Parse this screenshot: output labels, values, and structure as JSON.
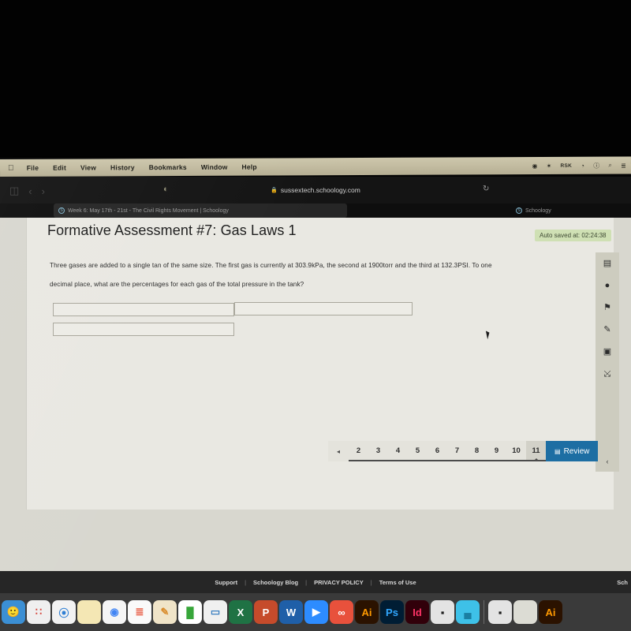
{
  "menubar": {
    "apple_icon": "apple-icon",
    "items": [
      "File",
      "Edit",
      "View",
      "History",
      "Bookmarks",
      "Window",
      "Help"
    ],
    "status_items": [
      {
        "name": "dropbox-icon",
        "glyph": "◉"
      },
      {
        "name": "bluetooth-icon",
        "glyph": "✶"
      },
      {
        "name": "rsk-icon",
        "glyph": "RSK"
      },
      {
        "name": "wifi-icon",
        "glyph": "◔"
      },
      {
        "name": "control-center-icon",
        "glyph": "ⓘ"
      },
      {
        "name": "spotlight-search-icon",
        "glyph": "⌕"
      },
      {
        "name": "siri-icon",
        "glyph": "≣"
      }
    ]
  },
  "browser": {
    "sidebar_toggle_icon": "sidebar-toggle-icon",
    "back_icon": "‹",
    "forward_icon": "›",
    "shield_icon": "◐",
    "lock_icon": "🔒",
    "url": "sussextech.schoology.com",
    "reload_icon": "↻",
    "tabs": [
      {
        "favicon": "S",
        "label": "Week 6: May 17th - 21st - The Civil Rights Movement | Schoology",
        "active": true
      },
      {
        "favicon": "S",
        "label": "Schoology",
        "active": false
      }
    ]
  },
  "assessment": {
    "title": "Formative Assessment #7: Gas Laws 1",
    "autosave": "Auto saved at: 02:24:38",
    "question_line_1": "Three gases are added to a single tan of the same size.  The first gas is currently at 303.9kPa, the second at 1900torr and the third at 132.3PSI.  To one",
    "question_line_2": "decimal place, what are the percentages for each gas of the total pressure in the tank?",
    "answer_fields": [
      {
        "name": "answer-field-1a",
        "value": "",
        "placeholder": ""
      },
      {
        "name": "answer-field-1b",
        "value": "",
        "placeholder": ""
      },
      {
        "name": "answer-field-2",
        "value": "",
        "placeholder": ""
      }
    ]
  },
  "toolrail": {
    "icons": [
      {
        "name": "calendar-icon",
        "glyph": "Ὄ5"
      },
      {
        "name": "clock-icon",
        "glyph": "●"
      },
      {
        "name": "flag-icon",
        "glyph": "⚑"
      },
      {
        "name": "pencil-annotate-icon",
        "glyph": "✎"
      },
      {
        "name": "calculator-icon",
        "glyph": "▣"
      },
      {
        "name": "fullscreen-expand-icon",
        "glyph": "⤡"
      }
    ],
    "collapse_icon": "‹"
  },
  "pager": {
    "prev_icon": "◂",
    "pages": [
      "2",
      "3",
      "4",
      "5",
      "6",
      "7",
      "8",
      "9",
      "10",
      "11"
    ],
    "active_page": "11",
    "review_icon": "Ὄ5",
    "review_label": "Review"
  },
  "footer": {
    "links": [
      "Support",
      "Schoology Blog",
      "PRIVACY POLICY",
      "Terms of Use"
    ],
    "separator": "|",
    "right_label": "Sch"
  },
  "dock": {
    "items": [
      {
        "name": "dock-finder",
        "label": "🙂",
        "bg": "#3b8fd4",
        "color": "#ffffff"
      },
      {
        "name": "dock-launchpad",
        "label": "∷",
        "bg": "#efefef",
        "color": "#d6453c"
      },
      {
        "name": "dock-safari",
        "label": "⦿",
        "bg": "#f2f2f2",
        "color": "#2f7fd4"
      },
      {
        "name": "dock-notes",
        "label": "",
        "bg": "#f4e7b4",
        "color": "#8a7a3a"
      },
      {
        "name": "dock-chrome",
        "label": "◉",
        "bg": "#f5f5f5",
        "color": "#4285f4"
      },
      {
        "name": "dock-reminders",
        "label": "≣",
        "bg": "#fafafa",
        "color": "#e8573f"
      },
      {
        "name": "dock-pages",
        "label": "✎",
        "bg": "#f0e4c8",
        "color": "#d98b2b"
      },
      {
        "name": "dock-numbers",
        "label": "█",
        "bg": "#ffffff",
        "color": "#37a63a"
      },
      {
        "name": "dock-keynote",
        "label": "▭",
        "bg": "#f0f0f0",
        "color": "#3a7fc1"
      },
      {
        "name": "dock-excel",
        "label": "X",
        "bg": "#1f7244",
        "color": "#ffffff"
      },
      {
        "name": "dock-powerpoint",
        "label": "P",
        "bg": "#c64b2b",
        "color": "#ffffff"
      },
      {
        "name": "dock-word",
        "label": "W",
        "bg": "#1f5fa8",
        "color": "#ffffff"
      },
      {
        "name": "dock-zoom",
        "label": "▶",
        "bg": "#2d8cff",
        "color": "#ffffff"
      },
      {
        "name": "dock-creative-cloud",
        "label": "∞",
        "bg": "#e8513c",
        "color": "#ffffff"
      },
      {
        "name": "dock-illustrator",
        "label": "Ai",
        "bg": "#2b1200",
        "color": "#ff9a00"
      },
      {
        "name": "dock-photoshop",
        "label": "Ps",
        "bg": "#001d34",
        "color": "#31a8ff"
      },
      {
        "name": "dock-indesign",
        "label": "Id",
        "bg": "#31000a",
        "color": "#ff3366"
      },
      {
        "name": "dock-roblox-1",
        "label": "▪",
        "bg": "#e3e3e3",
        "color": "#1a1a1a"
      },
      {
        "name": "dock-teams",
        "label": "▄",
        "bg": "#3ec1e8",
        "color": "#1a7fa3"
      },
      {
        "name": "dock-separator",
        "label": "",
        "bg": "",
        "color": ""
      },
      {
        "name": "dock-roblox-2",
        "label": "▪",
        "bg": "#e3e3e3",
        "color": "#1a1a1a"
      },
      {
        "name": "dock-blank-window",
        "label": "",
        "bg": "#dcdcd4",
        "color": "#888888"
      },
      {
        "name": "dock-illustrator-2",
        "label": "Ai",
        "bg": "#2b1200",
        "color": "#ff9a00"
      }
    ]
  }
}
